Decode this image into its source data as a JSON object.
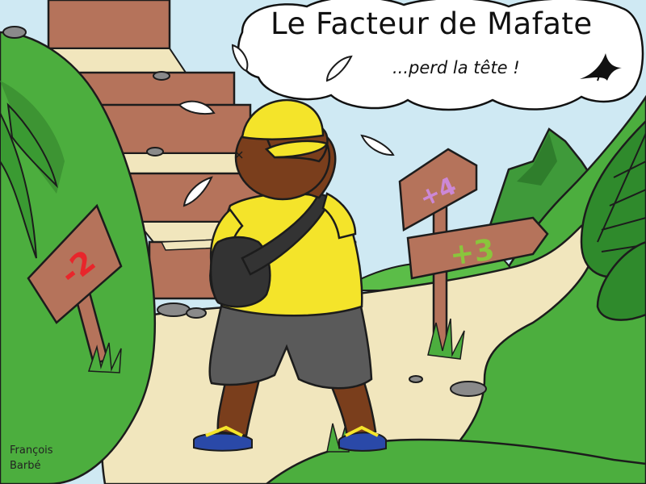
{
  "title": "Le Facteur de Mafate",
  "subtitle": "...perd la tête !",
  "author": {
    "first_name": "François",
    "last_name": "Barbé"
  },
  "signs": {
    "left": {
      "text": "-2",
      "color": "#e8262b"
    },
    "upper_right": {
      "text": "+4",
      "color": "#cc88d6"
    },
    "lower_right": {
      "text": "+3",
      "color": "#8ac53c"
    }
  },
  "colors": {
    "sky": "#cfe9f3",
    "grass": "#4cae3e",
    "path": "#f1e6bd",
    "wood": "#b5735b",
    "cap_shirt": "#f4e42a",
    "shorts": "#5a5a5a",
    "skin": "#7a3e1c"
  },
  "icons": [
    "bird-logo-icon",
    "sweat-drop-icon"
  ]
}
